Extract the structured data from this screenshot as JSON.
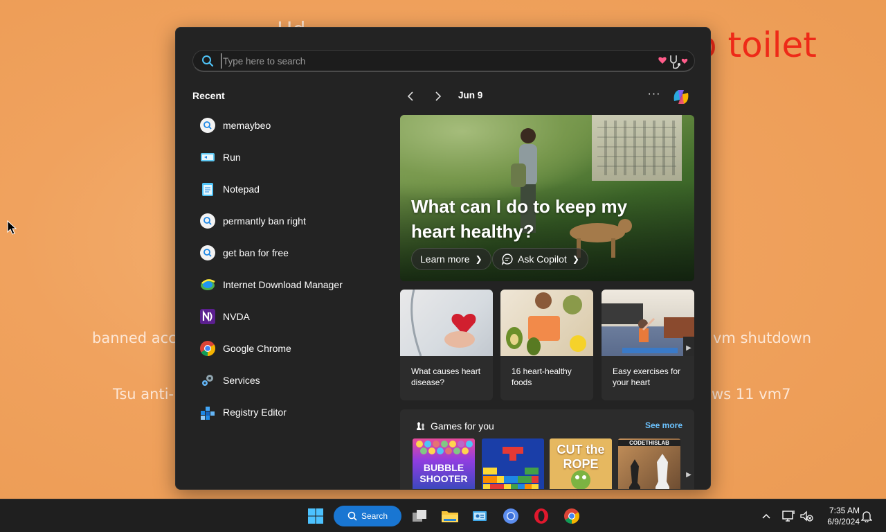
{
  "wallpaper": {
    "text_toilet": "o toilet",
    "text_hd": "Hd",
    "text_banned": "banned acco",
    "text_vm_shutdown": "vm shutdown",
    "text_tsu": "Tsu anti-l",
    "text_ws11": "ws 11 vm7"
  },
  "search": {
    "placeholder": "Type here to search"
  },
  "recent": {
    "title": "Recent",
    "items": [
      {
        "label": "memaybeo",
        "icon": "search-icon"
      },
      {
        "label": "Run",
        "icon": "run-icon"
      },
      {
        "label": "Notepad",
        "icon": "notepad-icon"
      },
      {
        "label": "permantly ban right",
        "icon": "search-icon"
      },
      {
        "label": "get ban for free",
        "icon": "search-icon"
      },
      {
        "label": "Internet Download Manager",
        "icon": "idm-icon"
      },
      {
        "label": "NVDA",
        "icon": "nvda-icon"
      },
      {
        "label": "Google Chrome",
        "icon": "chrome-icon"
      },
      {
        "label": "Services",
        "icon": "services-icon"
      },
      {
        "label": "Registry Editor",
        "icon": "registry-editor-icon"
      }
    ]
  },
  "feed": {
    "date": "Jun 9",
    "more": "···",
    "hero": {
      "title": "What can I do to keep my heart healthy?",
      "learn_more": "Learn more",
      "ask_copilot": "Ask Copilot"
    },
    "cards": [
      {
        "title": "What causes heart disease?"
      },
      {
        "title": "16 heart-healthy foods"
      },
      {
        "title": "Easy exercises for your heart"
      }
    ],
    "games": {
      "title": "Games for you",
      "see_more": "See more",
      "tiles": [
        {
          "title": "BUBBLE SHOOTER"
        },
        {
          "title": ""
        },
        {
          "title": "CUT the ROPE"
        },
        {
          "title": "CODETHISLAB"
        }
      ]
    }
  },
  "taskbar": {
    "search_label": "Search",
    "time": "7:35 AM",
    "date": "6/9/2024"
  },
  "colors": {
    "accent": "#1976d2",
    "link": "#6cc3ff",
    "panel_bg": "#232323"
  }
}
